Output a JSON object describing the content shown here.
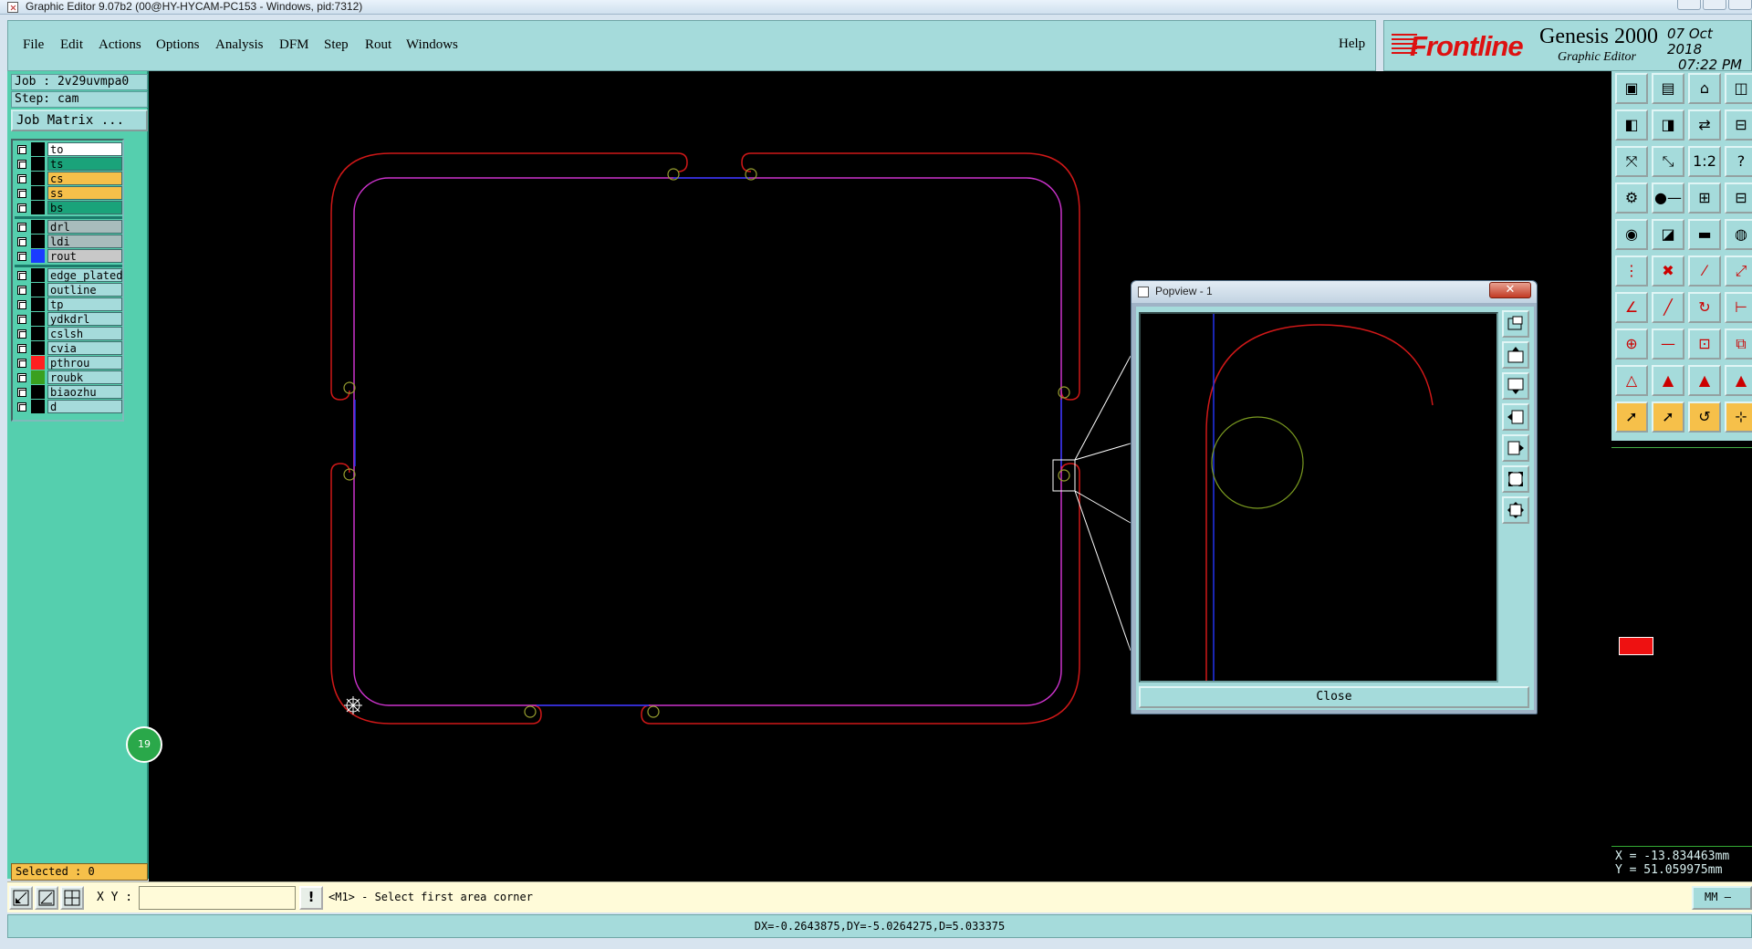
{
  "window": {
    "title": "Graphic Editor 9.07b2 (00@HY-HYCAM-PC153 - Windows, pid:7312)"
  },
  "menu": {
    "items": [
      "File",
      "Edit",
      "Actions",
      "Options",
      "Analysis",
      "DFM",
      "Step",
      "Rout",
      "Windows"
    ],
    "help": "Help"
  },
  "brand": {
    "logo": "Frontline",
    "product": "Genesis 2000",
    "subtitle": "Graphic Editor",
    "date": "07 Oct 2018",
    "time": "07:22 PM"
  },
  "job": {
    "job_line": "Job : 2v29uvmpa0",
    "step_line": "Step: cam",
    "matrix_button": "Job Matrix ..."
  },
  "layers": [
    {
      "name": "to",
      "swatch": "#000000",
      "bg": "#ffffff"
    },
    {
      "name": "ts",
      "swatch": "#000000",
      "bg": "#1aa37a"
    },
    {
      "name": "cs",
      "swatch": "#000000",
      "bg": "#f6c04a"
    },
    {
      "name": "ss",
      "swatch": "#000000",
      "bg": "#f6c04a"
    },
    {
      "name": "bs",
      "swatch": "#000000",
      "bg": "#1aa37a"
    },
    {
      "name": "drl",
      "swatch": "#000000",
      "bg": "#a8bcbc"
    },
    {
      "name": "ldi",
      "swatch": "#000000",
      "bg": "#a8bcbc"
    },
    {
      "name": "rout",
      "swatch": "#1a3cff",
      "bg": "#c8c8c8"
    },
    {
      "name": "edge_plated",
      "swatch": "#000000",
      "bg": "#a5dbdb"
    },
    {
      "name": "outline",
      "swatch": "#000000",
      "bg": "#a5dbdb"
    },
    {
      "name": "tp",
      "swatch": "#000000",
      "bg": "#a5dbdb"
    },
    {
      "name": "ydkdrl",
      "swatch": "#000000",
      "bg": "#a5dbdb"
    },
    {
      "name": "cslsh",
      "swatch": "#000000",
      "bg": "#a5dbdb"
    },
    {
      "name": "cvia",
      "swatch": "#000000",
      "bg": "#a5dbdb"
    },
    {
      "name": "pthrou",
      "swatch": "#ff2020",
      "bg": "#a5dbdb"
    },
    {
      "name": "roubk",
      "swatch": "#3aa020",
      "bg": "#a5dbdb"
    },
    {
      "name": "biaozhu",
      "swatch": "#000000",
      "bg": "#a5dbdb"
    },
    {
      "name": "d",
      "swatch": "#000000",
      "bg": "#a5dbdb"
    }
  ],
  "selected": "Selected : 0",
  "coords": {
    "x": "X = -13.834463mm",
    "y": "Y = 51.059975mm"
  },
  "right_badge": "19",
  "command": {
    "xy_label": "X Y :",
    "xy_value": "",
    "prompt": "<M1> - Select first area corner",
    "unit": "MM"
  },
  "status": "DX=-0.2643875,DY=-5.0264275,D=5.033375",
  "popview": {
    "title": "Popview - 1",
    "close_label": "Close"
  },
  "colors": {
    "panel": "#a5dbdb",
    "left_panel": "#55cfae",
    "canvas": "#000000",
    "rout_red": "#d01818",
    "profile_magenta": "#cc33cc",
    "rout_blue": "#2233ee",
    "hole_olive": "#9aa030"
  },
  "icons": {
    "toolbar": [
      "zoom-home-icon",
      "pan-icon",
      "snap-icon",
      "measure-icon",
      "feature-icon",
      "select-icon"
    ]
  }
}
